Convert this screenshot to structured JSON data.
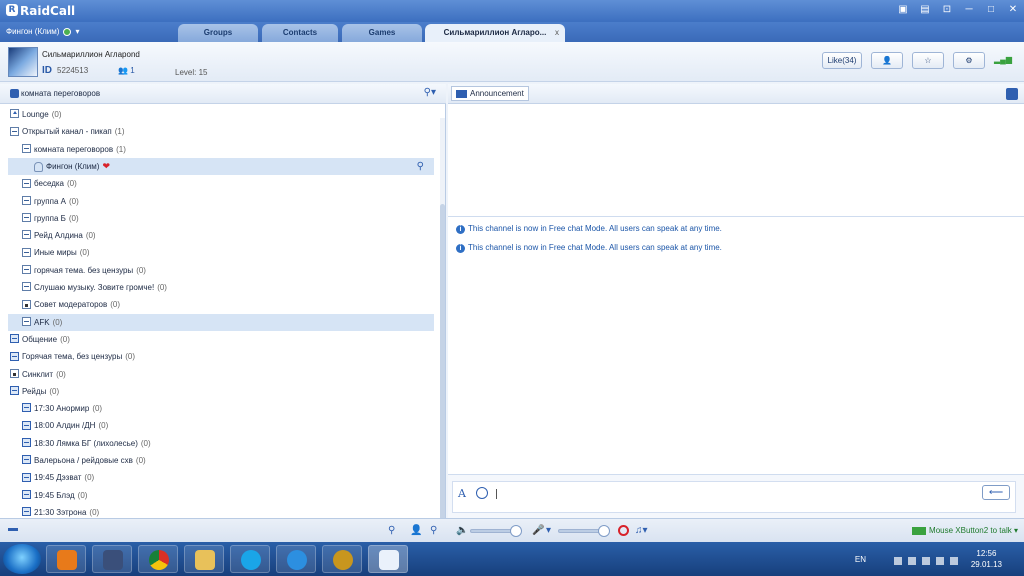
{
  "app": {
    "name": "RaidCall",
    "window_controls": [
      "▣",
      "👕",
      "⊡",
      "─",
      "□",
      "✕"
    ]
  },
  "status_bar": {
    "user_name": "Фингон (Клим)",
    "status_color": "#4caf50"
  },
  "tabs": [
    {
      "label": "Groups"
    },
    {
      "label": "Contacts"
    },
    {
      "label": "Games"
    },
    {
      "label": "Сильмариллион Агларо...",
      "close": "x"
    }
  ],
  "channel": {
    "name": "Сильмариллион Аглароnd",
    "id_label": "ID",
    "id": "5224513",
    "members": "1",
    "level": "Level: 15",
    "like_button": "Like(34)"
  },
  "left_pane": {
    "title": "комната переговоров",
    "tree": [
      {
        "label": "Lounge",
        "count": "(0)",
        "type": "home"
      },
      {
        "label": "Открытый канал - пикап",
        "count": "(1)",
        "type": "minus"
      },
      {
        "label": "комната переговоров",
        "count": "(1)",
        "type": "minus"
      },
      {
        "label": "Фингон (Клим)",
        "count": "",
        "type": "user"
      },
      {
        "label": "беседка",
        "count": "(0)",
        "type": "minus"
      },
      {
        "label": "группа А",
        "count": "(0)",
        "type": "minus"
      },
      {
        "label": "группа Б",
        "count": "(0)",
        "type": "minus"
      },
      {
        "label": "Рейд Алдина",
        "count": "(0)",
        "type": "minus"
      },
      {
        "label": "Иные миры",
        "count": "(0)",
        "type": "minus"
      },
      {
        "label": "горячая тема. без цензуры",
        "count": "(0)",
        "type": "minus"
      },
      {
        "label": "Слушаю музыку. Зовите громче!",
        "count": "(0)",
        "type": "minus"
      },
      {
        "label": "Совет модераторов",
        "count": "(0)",
        "type": "lock"
      },
      {
        "label": "AFK",
        "count": "(0)",
        "type": "minus"
      },
      {
        "label": "Общение",
        "count": "(0)",
        "type": "blue"
      },
      {
        "label": "Горячая тема, без цензуры",
        "count": "(0)",
        "type": "blue"
      },
      {
        "label": "Синклит",
        "count": "(0)",
        "type": "lock"
      },
      {
        "label": "Рейды",
        "count": "(0)",
        "type": "blue"
      },
      {
        "label": "17:30 Анормир",
        "count": "(0)",
        "type": "blue"
      },
      {
        "label": "18:00 Алдин /ДН",
        "count": "(0)",
        "type": "blue"
      },
      {
        "label": "18:30 Лямка  БГ (лихолесье)",
        "count": "(0)",
        "type": "blue"
      },
      {
        "label": "Валерьона / рейдовые схв",
        "count": "(0)",
        "type": "blue"
      },
      {
        "label": "19:45 Дэзват",
        "count": "(0)",
        "type": "blue"
      },
      {
        "label": "19:45 Блэд",
        "count": "(0)",
        "type": "blue"
      },
      {
        "label": "21:30 Зэтрона",
        "count": "(0)",
        "type": "blue"
      }
    ]
  },
  "right_pane": {
    "announcement_button": "Announcement",
    "messages": [
      "This channel is now in Free chat Mode. All users can speak at any time.",
      "This channel is now in Free chat Mode. All users can speak at any time."
    ],
    "send_symbol": "⟵"
  },
  "bottom_bar": {
    "push_to_talk": "Mouse XButton2 to talk"
  },
  "taskbar": {
    "language": "EN",
    "time": "12:56",
    "date": "29.01.13"
  }
}
